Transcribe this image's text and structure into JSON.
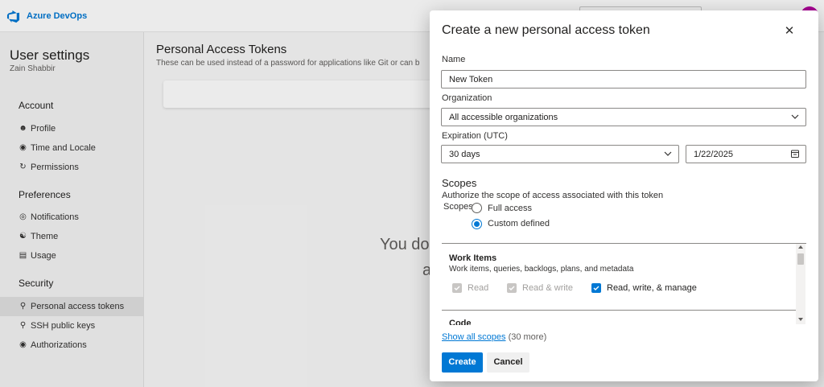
{
  "app": {
    "brand": "Azure DevOps"
  },
  "sidebar": {
    "title": "User settings",
    "user": "Zain Shabbir",
    "sections": [
      {
        "label": "Account",
        "items": [
          {
            "label": "Profile",
            "icon": "person-icon"
          },
          {
            "label": "Time and Locale",
            "icon": "globe-icon"
          },
          {
            "label": "Permissions",
            "icon": "refresh-icon"
          }
        ]
      },
      {
        "label": "Preferences",
        "items": [
          {
            "label": "Notifications",
            "icon": "notification-icon"
          },
          {
            "label": "Theme",
            "icon": "palette-icon"
          },
          {
            "label": "Usage",
            "icon": "usage-icon"
          }
        ]
      },
      {
        "label": "Security",
        "items": [
          {
            "label": "Personal access tokens",
            "icon": "key-icon",
            "active": true
          },
          {
            "label": "SSH public keys",
            "icon": "ssh-key-icon"
          },
          {
            "label": "Authorizations",
            "icon": "lock-icon"
          }
        ]
      }
    ]
  },
  "main": {
    "title": "Personal Access Tokens",
    "subtitle": "These can be used instead of a password for applications like Git or can b",
    "empty_line1": "You do",
    "empty_line2": "a"
  },
  "dialog": {
    "title": "Create a new personal access token",
    "name_label": "Name",
    "name_value": "New Token",
    "org_label": "Organization",
    "org_value": "All accessible organizations",
    "expiration_label": "Expiration (UTC)",
    "expiration_value": "30 days",
    "date_value": "1/22/2025",
    "scopes_heading": "Scopes",
    "scopes_desc": "Authorize the scope of access associated with this token",
    "scopes_label": "Scopes",
    "radio_full": "Full access",
    "radio_custom": "Custom defined",
    "selected_radio": "Custom defined",
    "work_items": {
      "title": "Work Items",
      "desc": "Work items, queries, backlogs, plans, and metadata",
      "options": [
        {
          "label": "Read",
          "checked": true,
          "disabled": true
        },
        {
          "label": "Read & write",
          "checked": true,
          "disabled": true
        },
        {
          "label": "Read, write, & manage",
          "checked": true,
          "disabled": false
        }
      ]
    },
    "next_section": "Code",
    "show_all_link": "Show all scopes",
    "show_all_more": "(30 more)",
    "create_label": "Create",
    "cancel_label": "Cancel"
  },
  "colors": {
    "accent": "#0078d4"
  }
}
